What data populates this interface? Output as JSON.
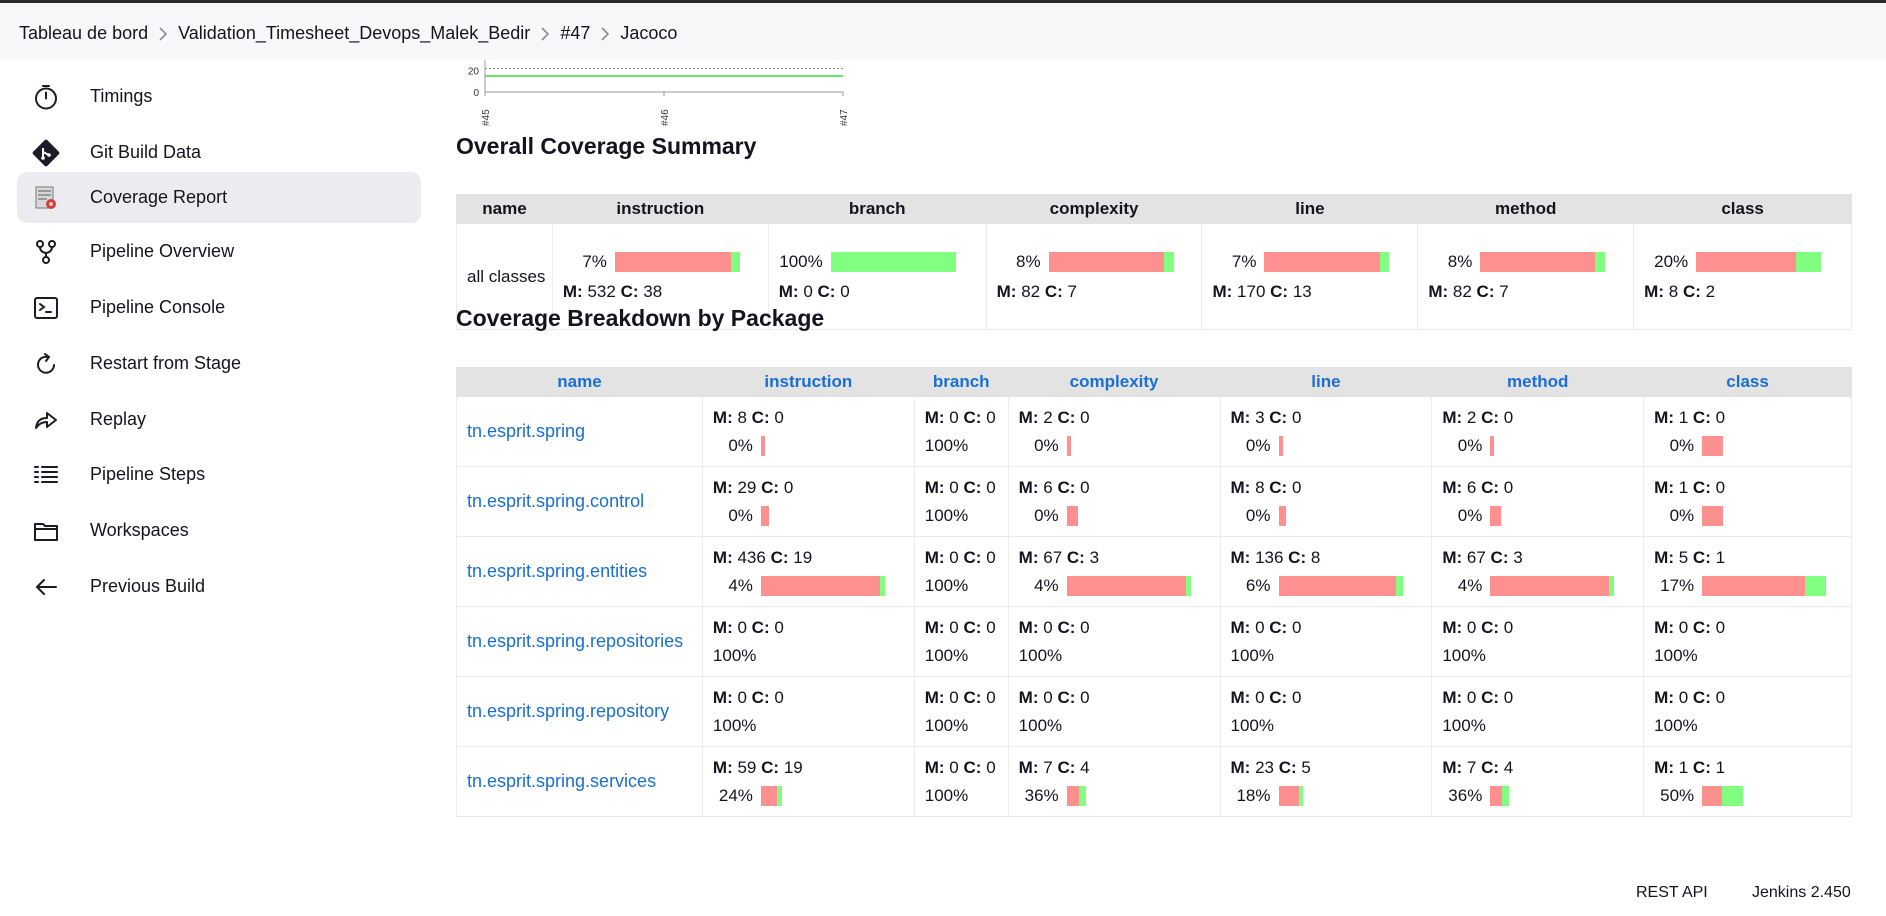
{
  "breadcrumb": [
    "Tableau de bord",
    "Validation_Timesheet_Devops_Malek_Bedir",
    "#47",
    "Jacoco"
  ],
  "sidebar": {
    "items": [
      {
        "label": "Timings",
        "icon": "timer-icon"
      },
      {
        "label": "Git Build Data",
        "icon": "git-icon"
      },
      {
        "label": "Coverage Report",
        "icon": "coverage-report-icon",
        "active": true
      },
      {
        "label": "Pipeline Overview",
        "icon": "pipeline-branch-icon"
      },
      {
        "label": "Pipeline Console",
        "icon": "terminal-icon"
      },
      {
        "label": "Restart from Stage",
        "icon": "restart-icon"
      },
      {
        "label": "Replay",
        "icon": "replay-arrow-icon"
      },
      {
        "label": "Pipeline Steps",
        "icon": "list-icon"
      },
      {
        "label": "Workspaces",
        "icon": "folder-icon"
      },
      {
        "label": "Previous Build",
        "icon": "arrow-left-icon"
      }
    ]
  },
  "chart_data": {
    "type": "line",
    "x": [
      "#45",
      "#46",
      "#47"
    ],
    "yticks": [
      "20",
      "0"
    ],
    "series": [
      {
        "values": [
          15,
          15,
          15
        ],
        "color": "#33dd33"
      },
      {
        "values": [
          22,
          22,
          22
        ],
        "color": "#888888",
        "style": "dotted"
      }
    ]
  },
  "summary": {
    "title": "Overall Coverage Summary",
    "headers": [
      "name",
      "instruction",
      "branch",
      "complexity",
      "line",
      "method",
      "class"
    ],
    "row": {
      "name": "all classes",
      "cells": [
        {
          "pct": "7%",
          "m": "532",
          "c": "38"
        },
        {
          "pct": "100%",
          "m": "0",
          "c": "0"
        },
        {
          "pct": "8%",
          "m": "82",
          "c": "7"
        },
        {
          "pct": "7%",
          "m": "170",
          "c": "13"
        },
        {
          "pct": "8%",
          "m": "82",
          "c": "7"
        },
        {
          "pct": "20%",
          "m": "8",
          "c": "2"
        }
      ]
    }
  },
  "breakdown": {
    "title": "Coverage Breakdown by Package",
    "headers": [
      "name",
      "instruction",
      "branch",
      "complexity",
      "line",
      "method",
      "class"
    ],
    "m_label": "M:",
    "c_label": "C:",
    "rows": [
      {
        "name": "tn.esprit.spring",
        "cells": [
          {
            "m": "8",
            "c": "0",
            "pct": "0%"
          },
          {
            "m": "0",
            "c": "0",
            "pct": "100%"
          },
          {
            "m": "2",
            "c": "0",
            "pct": "0%"
          },
          {
            "m": "3",
            "c": "0",
            "pct": "0%"
          },
          {
            "m": "2",
            "c": "0",
            "pct": "0%"
          },
          {
            "m": "1",
            "c": "0",
            "pct": "0%"
          }
        ]
      },
      {
        "name": "tn.esprit.spring.control",
        "cells": [
          {
            "m": "29",
            "c": "0",
            "pct": "0%"
          },
          {
            "m": "0",
            "c": "0",
            "pct": "100%"
          },
          {
            "m": "6",
            "c": "0",
            "pct": "0%"
          },
          {
            "m": "8",
            "c": "0",
            "pct": "0%"
          },
          {
            "m": "6",
            "c": "0",
            "pct": "0%"
          },
          {
            "m": "1",
            "c": "0",
            "pct": "0%"
          }
        ]
      },
      {
        "name": "tn.esprit.spring.entities",
        "cells": [
          {
            "m": "436",
            "c": "19",
            "pct": "4%"
          },
          {
            "m": "0",
            "c": "0",
            "pct": "100%"
          },
          {
            "m": "67",
            "c": "3",
            "pct": "4%"
          },
          {
            "m": "136",
            "c": "8",
            "pct": "6%"
          },
          {
            "m": "67",
            "c": "3",
            "pct": "4%"
          },
          {
            "m": "5",
            "c": "1",
            "pct": "17%"
          }
        ]
      },
      {
        "name": "tn.esprit.spring.repositories",
        "cells": [
          {
            "m": "0",
            "c": "0",
            "pct": "100%"
          },
          {
            "m": "0",
            "c": "0",
            "pct": "100%"
          },
          {
            "m": "0",
            "c": "0",
            "pct": "100%"
          },
          {
            "m": "0",
            "c": "0",
            "pct": "100%"
          },
          {
            "m": "0",
            "c": "0",
            "pct": "100%"
          },
          {
            "m": "0",
            "c": "0",
            "pct": "100%"
          }
        ]
      },
      {
        "name": "tn.esprit.spring.repository",
        "cells": [
          {
            "m": "0",
            "c": "0",
            "pct": "100%"
          },
          {
            "m": "0",
            "c": "0",
            "pct": "100%"
          },
          {
            "m": "0",
            "c": "0",
            "pct": "100%"
          },
          {
            "m": "0",
            "c": "0",
            "pct": "100%"
          },
          {
            "m": "0",
            "c": "0",
            "pct": "100%"
          },
          {
            "m": "0",
            "c": "0",
            "pct": "100%"
          }
        ]
      },
      {
        "name": "tn.esprit.spring.services",
        "cells": [
          {
            "m": "59",
            "c": "19",
            "pct": "24%"
          },
          {
            "m": "0",
            "c": "0",
            "pct": "100%"
          },
          {
            "m": "7",
            "c": "4",
            "pct": "36%"
          },
          {
            "m": "23",
            "c": "5",
            "pct": "18%"
          },
          {
            "m": "7",
            "c": "4",
            "pct": "36%"
          },
          {
            "m": "1",
            "c": "1",
            "pct": "50%"
          }
        ]
      }
    ]
  },
  "footer": {
    "rest_api": "REST API",
    "version": "Jenkins 2.450"
  },
  "colors": {
    "missed": "#ff9090",
    "covered": "#80ff80",
    "link": "#1a6fd0"
  }
}
